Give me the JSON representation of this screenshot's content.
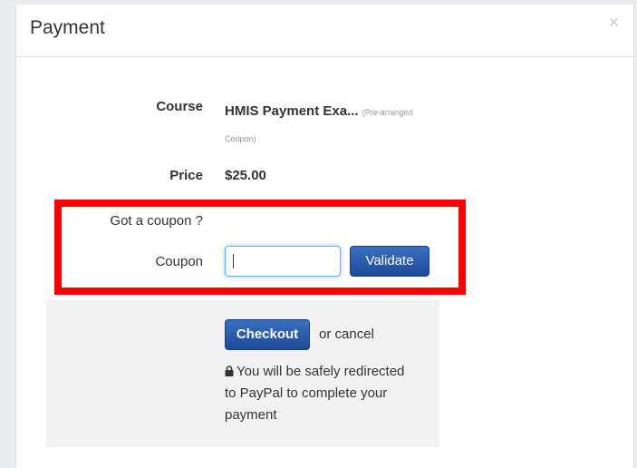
{
  "modal": {
    "title": "Payment",
    "close_label": "×"
  },
  "course": {
    "label": "Course",
    "title": "HMIS Payment Exa...",
    "note": "(Pre-arranged Coupon)"
  },
  "price": {
    "label": "Price",
    "value": "$25.00"
  },
  "coupon": {
    "prompt": "Got a coupon ?",
    "label": "Coupon",
    "value": "",
    "placeholder": "",
    "validate_label": "Validate"
  },
  "footer": {
    "checkout_label": "Checkout",
    "cancel_text": "or cancel",
    "paypal_note": "You will be safely redirected to PayPal to complete your payment"
  },
  "icons": {
    "close": "close-icon",
    "lock": "lock-icon"
  },
  "colors": {
    "primary_button": "#1d4b9a",
    "highlight": "#ff0000",
    "footer_background": "#f2f2f2"
  }
}
